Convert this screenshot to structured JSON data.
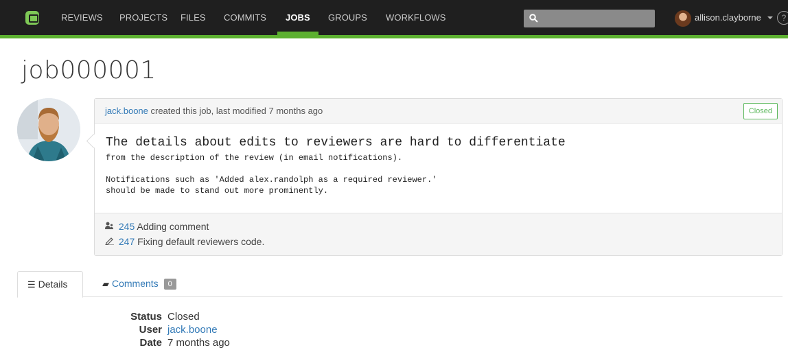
{
  "nav": {
    "items": [
      {
        "label": "REVIEWS",
        "active": false
      },
      {
        "label": "PROJECTS",
        "active": false
      },
      {
        "label": "FILES",
        "active": false
      },
      {
        "label": "COMMITS",
        "active": false
      },
      {
        "label": "JOBS",
        "active": true
      },
      {
        "label": "GROUPS",
        "active": false
      },
      {
        "label": "WORKFLOWS",
        "active": false
      }
    ],
    "user": "allison.clayborne",
    "help": "?"
  },
  "job": {
    "title": "job000001",
    "author": "jack.boone",
    "created_text": " created this job, last modified 7 months ago",
    "status_badge": "Closed",
    "description": {
      "title": "The details about edits to reviewers are hard to differentiate",
      "line1": "from the description of the review (in email notifications).",
      "line2": "Notifications such as 'Added alex.randolph as a required reviewer.'",
      "line3": "should be made to stand out more prominently."
    },
    "links": [
      {
        "id": "245",
        "text": "Adding comment",
        "icon": "review-icon"
      },
      {
        "id": "247",
        "text": "Fixing default reviewers code.",
        "icon": "commit-pencil-icon"
      }
    ]
  },
  "tabs": {
    "details": "Details",
    "comments": "Comments",
    "comments_count": "0"
  },
  "details": {
    "status_label": "Status",
    "status_value": "Closed",
    "user_label": "User",
    "user_value": "jack.boone",
    "date_label": "Date",
    "date_value": "7 months ago"
  },
  "colors": {
    "navbar": "#1f1f1f",
    "accent": "#5cb030",
    "link": "#337ab7",
    "closed": "#5cb85c"
  }
}
